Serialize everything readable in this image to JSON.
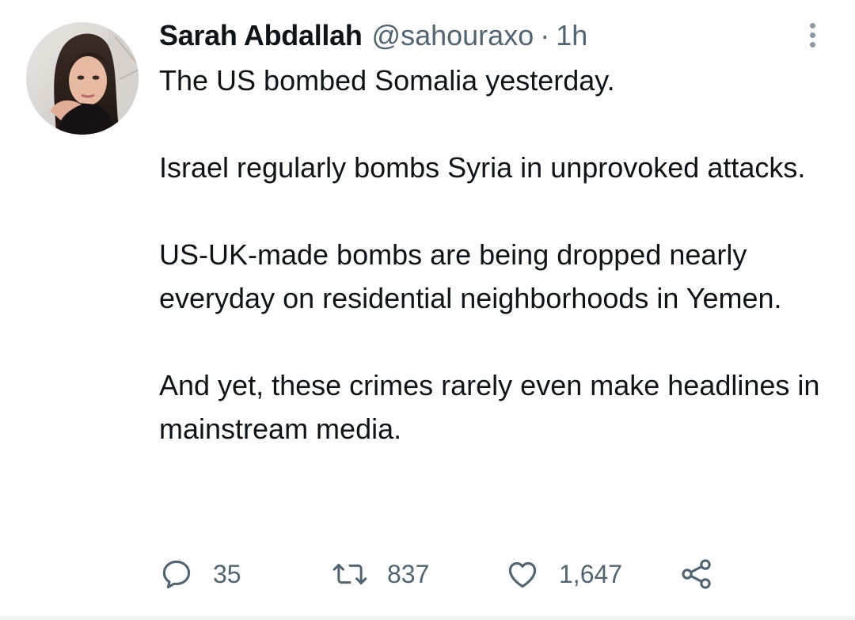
{
  "tweet": {
    "author": {
      "display_name": "Sarah Abdallah",
      "handle": "@sahouraxo",
      "separator": "·",
      "timestamp": "1h",
      "avatar_icon": "profile-photo"
    },
    "paragraphs": [
      "The US bombed Somalia yesterday.",
      "Israel regularly bombs Syria in unprovoked attacks.",
      "US-UK-made bombs are being dropped nearly everyday on residential neighborhoods in Yemen.",
      "And yet, these crimes rarely even make headlines in mainstream media."
    ],
    "actions": {
      "reply": {
        "icon": "reply-icon",
        "count": "35"
      },
      "retweet": {
        "icon": "retweet-icon",
        "count": "837"
      },
      "like": {
        "icon": "heart-icon",
        "count": "1,647"
      },
      "share": {
        "icon": "share-icon"
      }
    },
    "more_icon": "more-vertical-icon"
  },
  "colors": {
    "text_primary": "#0f1419",
    "text_secondary": "#536471",
    "more_dots": "#8b98a5",
    "divider": "#eff3f4",
    "background": "#ffffff"
  }
}
